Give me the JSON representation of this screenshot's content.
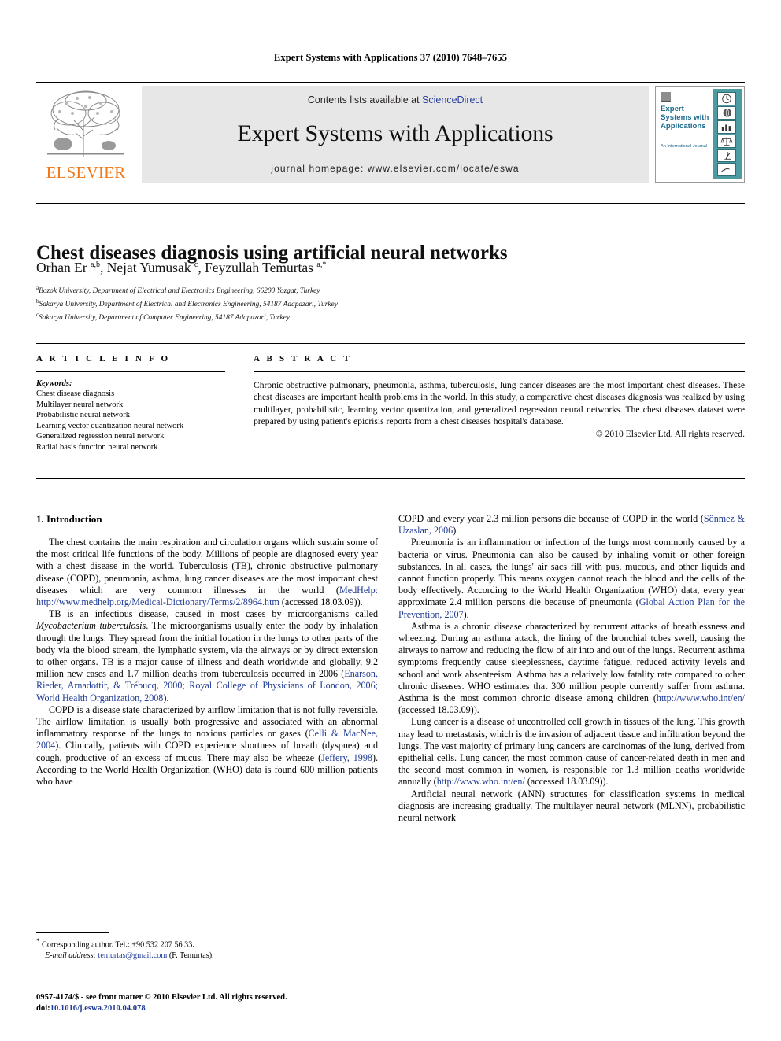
{
  "running_head": "Expert Systems with Applications 37 (2010) 7648–7655",
  "masthead": {
    "publisher": "ELSEVIER",
    "contents_prefix": "Contents lists available at ",
    "contents_link": "ScienceDirect",
    "journal_title": "Expert Systems with Applications",
    "homepage": "journal homepage: www.elsevier.com/locate/eswa",
    "cover": {
      "title": "Expert Systems with Applications",
      "subtitle": "An International Journal"
    }
  },
  "article": {
    "title": "Chest diseases diagnosis using artificial neural networks",
    "authors_html": "Orhan Er <sup>a,b</sup>, Nejat Yumusak <sup>c</sup>, Feyzullah Temurtas <sup>a,*</sup>",
    "affiliations": [
      "Bozok University, Department of Electrical and Electronics Engineering, 66200 Yozgat, Turkey",
      "Sakarya University, Department of Electrical and Electronics Engineering, 54187 Adapazari, Turkey",
      "Sakarya University, Department of Computer Engineering, 54187 Adapazari, Turkey"
    ],
    "affiliation_marks": [
      "a",
      "b",
      "c"
    ]
  },
  "info": {
    "heading": "A R T I C L E   I N F O",
    "keywords_label": "Keywords:",
    "keywords": [
      "Chest disease diagnosis",
      "Multilayer neural network",
      "Probabilistic neural network",
      "Learning vector quantization neural network",
      "Generalized regression neural network",
      "Radial basis function neural network"
    ]
  },
  "abstract": {
    "heading": "A B S T R A C T",
    "text": "Chronic obstructive pulmonary, pneumonia, asthma, tuberculosis, lung cancer diseases are the most important chest diseases. These chest diseases are important health problems in the world. In this study, a comparative chest diseases diagnosis was realized by using multilayer, probabilistic, learning vector quantization, and generalized regression neural networks. The chest diseases dataset were prepared by using patient's epicrisis reports from a chest diseases hospital's database.",
    "copyright": "© 2010 Elsevier Ltd. All rights reserved."
  },
  "body": {
    "section_heading": "1. Introduction",
    "left_paragraphs": [
      {
        "parts": [
          {
            "t": "The chest contains the main respiration and circulation organs which sustain some of the most critical life functions of the body. Millions of people are diagnosed every year with a chest disease in the world. Tuberculosis (TB), chronic obstructive pulmonary disease (COPD), pneumonia, asthma, lung cancer diseases are the most important chest diseases which are very common illnesses in the world (",
            "link": false
          },
          {
            "t": "MedHelp: http://www.medhelp.org/Medical-Dictionary/Terms/2/8964.htm",
            "link": true
          },
          {
            "t": " (accessed 18.03.09)).",
            "link": false
          }
        ]
      },
      {
        "parts": [
          {
            "t": "TB is an infectious disease, caused in most cases by microorganisms called ",
            "link": false
          },
          {
            "t": "Mycobacterium tuberculosis",
            "link": false,
            "italic": true
          },
          {
            "t": ". The microorganisms usually enter the body by inhalation through the lungs. They spread from the initial location in the lungs to other parts of the body via the blood stream, the lymphatic system, via the airways or by direct extension to other organs. TB is a major cause of illness and death worldwide and globally, 9.2 million new cases and 1.7 million deaths from tuberculosis occurred in 2006 (",
            "link": false
          },
          {
            "t": "Enarson, Rieder, Arnadottir, & Trébucq, 2000; Royal College of Physicians of London, 2006; World Health Organization, 2008",
            "link": true
          },
          {
            "t": ").",
            "link": false
          }
        ]
      },
      {
        "parts": [
          {
            "t": "COPD is a disease state characterized by airflow limitation that is not fully reversible. The airflow limitation is usually both progressive and associated with an abnormal inflammatory response of the lungs to noxious particles or gases (",
            "link": false
          },
          {
            "t": "Celli & MacNee, 2004",
            "link": true
          },
          {
            "t": "). Clinically, patients with COPD experience shortness of breath (dyspnea) and cough, productive of an excess of mucus. There may also be wheeze (",
            "link": false
          },
          {
            "t": "Jeffery, 1998",
            "link": true
          },
          {
            "t": "). According to the World Health Organization (WHO) data is found 600 million patients who have",
            "link": false
          }
        ]
      }
    ],
    "right_paragraphs": [
      {
        "continued": true,
        "parts": [
          {
            "t": "COPD and every year 2.3 million persons die because of COPD in the world (",
            "link": false
          },
          {
            "t": "Sönmez & Uzaslan, 2006",
            "link": true
          },
          {
            "t": ").",
            "link": false
          }
        ]
      },
      {
        "parts": [
          {
            "t": "Pneumonia is an inflammation or infection of the lungs most commonly caused by a bacteria or virus. Pneumonia can also be caused by inhaling vomit or other foreign substances. In all cases, the lungs' air sacs fill with pus, mucous, and other liquids and cannot function properly. This means oxygen cannot reach the blood and the cells of the body effectively. According to the World Health Organization (WHO) data, every year approximate 2.4 million persons die because of pneumonia (",
            "link": false
          },
          {
            "t": "Global Action Plan for the Prevention, 2007",
            "link": true
          },
          {
            "t": ").",
            "link": false
          }
        ]
      },
      {
        "parts": [
          {
            "t": "Asthma is a chronic disease characterized by recurrent attacks of breathlessness and wheezing. During an asthma attack, the lining of the bronchial tubes swell, causing the airways to narrow and reducing the flow of air into and out of the lungs. Recurrent asthma symptoms frequently cause sleeplessness, daytime fatigue, reduced activity levels and school and work absenteeism. Asthma has a relatively low fatality rate compared to other chronic diseases. WHO estimates that 300 million people currently suffer from asthma. Asthma is the most common chronic disease among children (",
            "link": false
          },
          {
            "t": "http://www.who.int/en/",
            "link": true
          },
          {
            "t": " (accessed 18.03.09)).",
            "link": false
          }
        ]
      },
      {
        "parts": [
          {
            "t": "Lung cancer is a disease of uncontrolled cell growth in tissues of the lung. This growth may lead to metastasis, which is the invasion of adjacent tissue and infiltration beyond the lungs. The vast majority of primary lung cancers are carcinomas of the lung, derived from epithelial cells. Lung cancer, the most common cause of cancer-related death in men and the second most common in women, is responsible for 1.3 million deaths worldwide annually (",
            "link": false
          },
          {
            "t": "http://www.who.int/en/",
            "link": true
          },
          {
            "t": " (accessed 18.03.09)).",
            "link": false
          }
        ]
      },
      {
        "parts": [
          {
            "t": "Artificial neural network (ANN) structures for classification systems in medical diagnosis are increasing gradually. The multilayer neural network (MLNN), probabilistic neural network",
            "link": false
          }
        ]
      }
    ]
  },
  "footnote": {
    "corresponding": "Corresponding author. Tel.: +90 532 207 56 33.",
    "email_label": "E-mail address:",
    "email": "temurtas@gmail.com",
    "email_suffix": "(F. Temurtas).",
    "issn_line": "0957-4174/$ - see front matter © 2010 Elsevier Ltd. All rights reserved.",
    "doi_label": "doi:",
    "doi": "10.1016/j.eswa.2010.04.078"
  },
  "colors": {
    "link": "#1f3a93",
    "sciencedirect": "#2b3f9e",
    "elsevier_orange": "#f07a1b",
    "band_gray": "#e7e7e7",
    "cover_teal": "#4d9aa0"
  }
}
